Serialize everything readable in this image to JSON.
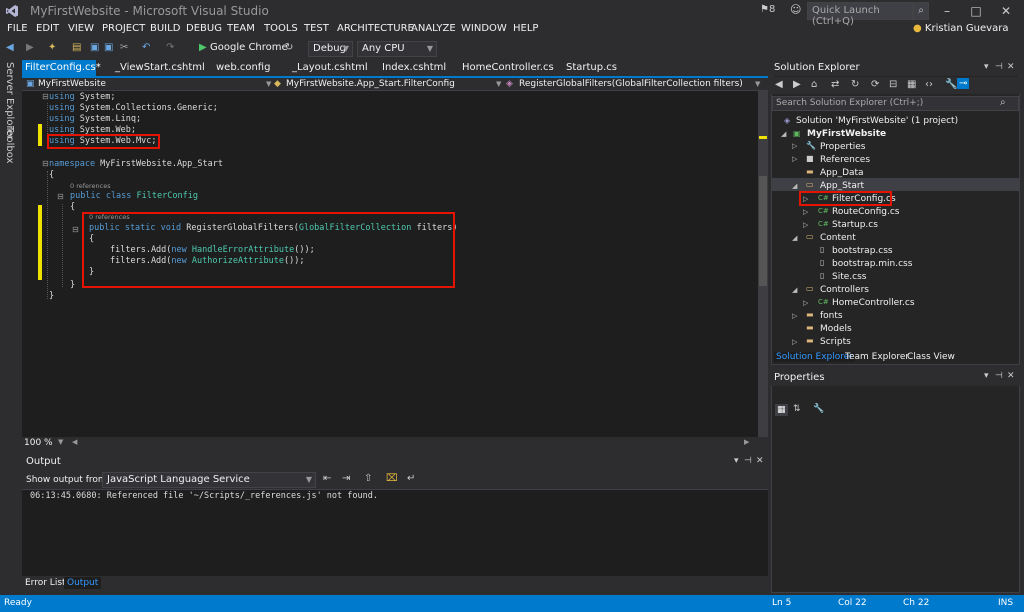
{
  "window": {
    "title": "MyFirstWebsite - Microsoft Visual Studio",
    "notifications": "8",
    "quick_launch_placeholder": "Quick Launch (Ctrl+Q)",
    "user": "Kristian Guevara"
  },
  "menu": [
    "FILE",
    "EDIT",
    "VIEW",
    "PROJECT",
    "BUILD",
    "DEBUG",
    "TEAM",
    "TOOLS",
    "TEST",
    "ARCHITECTURE",
    "ANALYZE",
    "WINDOW",
    "HELP"
  ],
  "toolbar": {
    "browser": "Google Chrome",
    "config": "Debug",
    "platform": "Any CPU"
  },
  "side_labels": [
    "Server Explorer",
    "Toolbox"
  ],
  "tabs": {
    "active": "FilterConfig.cs*",
    "others": [
      "_ViewStart.cshtml",
      "web.config",
      "_Layout.cshtml",
      "Index.cshtml",
      "HomeController.cs",
      "Startup.cs"
    ]
  },
  "nav": {
    "project": "MyFirstWebsite",
    "class": "MyFirstWebsite.App_Start.FilterConfig",
    "member": "RegisterGlobalFilters(GlobalFilterCollection filters)"
  },
  "code": {
    "u1_kw": "using",
    "u1": " System;",
    "u2_kw": "using",
    "u2": " System.Collections.Generic;",
    "u3_kw": "using",
    "u3": " System.Linq;",
    "u4_kw": "using",
    "u4": " System.Web;",
    "u5_kw": "using",
    "u5": " System.Web.Mvc;",
    "ns_kw": "namespace",
    "ns": " MyFirstWebsite.App_Start",
    "brace_open": "{",
    "brace_close": "}",
    "refs": "0 references",
    "cls_kw": "public class",
    "cls": "FilterConfig",
    "m_kw": "public static void",
    "m": " RegisterGlobalFilters(",
    "m_ty": "GlobalFilterCollection",
    "m_end": " filters)",
    "a1": "filters.Add(",
    "a1_kw": "new",
    "a1_ty": "HandleErrorAttribute",
    "a1_end": "());",
    "a2": "filters.Add(",
    "a2_kw": "new",
    "a2_ty": "AuthorizeAttribute",
    "a2_end": "());"
  },
  "zoom": "100 %",
  "output": {
    "title": "Output",
    "show_from_label": "Show output from:",
    "source": "JavaScript Language Service",
    "line": "06:13:45.0680: Referenced file '~/Scripts/_references.js' not found."
  },
  "bottom_tabs": [
    "Error List",
    "Output"
  ],
  "status": {
    "ready": "Ready",
    "ln": "Ln 5",
    "col": "Col 22",
    "ch": "Ch 22",
    "mode": "INS"
  },
  "solution_explorer": {
    "title": "Solution Explorer",
    "search_placeholder": "Search Solution Explorer (Ctrl+;)",
    "items": [
      "Solution 'MyFirstWebsite' (1 project)",
      "MyFirstWebsite",
      "Properties",
      "References",
      "App_Data",
      "App_Start",
      "FilterConfig.cs",
      "RouteConfig.cs",
      "Startup.cs",
      "Content",
      "bootstrap.css",
      "bootstrap.min.css",
      "Site.css",
      "Controllers",
      "HomeController.cs",
      "fonts",
      "Models",
      "Scripts"
    ],
    "tabs": [
      "Solution Explorer",
      "Team Explorer",
      "Class View"
    ],
    "cs_badge": "C#"
  },
  "properties": {
    "title": "Properties"
  },
  "colors": {
    "accent": "#007acc",
    "highlight": "#e51400",
    "keyword": "#569cd6",
    "type": "#4ec9b0"
  }
}
